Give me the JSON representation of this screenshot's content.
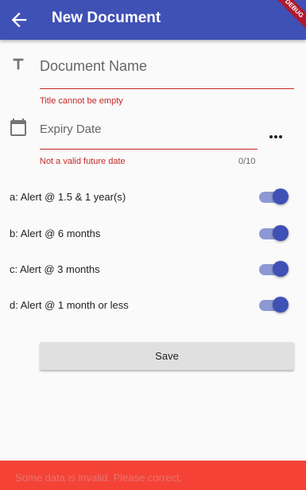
{
  "appbar": {
    "title": "New Document",
    "debug_banner": "DEBUG"
  },
  "form": {
    "name": {
      "placeholder": "Document Name",
      "error": "Title cannot be empty"
    },
    "expiry": {
      "placeholder": "Expiry Date",
      "error": "Not a valid future date",
      "counter": "0/10"
    },
    "alerts": [
      {
        "label": "a: Alert @ 1.5 & 1 year(s)",
        "enabled": true
      },
      {
        "label": "b: Alert @ 6 months",
        "enabled": true
      },
      {
        "label": "c: Alert @ 3 months",
        "enabled": true
      },
      {
        "label": "d: Alert @ 1 month or less",
        "enabled": true
      }
    ],
    "save_label": "Save"
  },
  "snackbar": {
    "message": "Some data is invalid. Please correct."
  },
  "colors": {
    "primary": "#3f51b5",
    "error": "#c62828",
    "snackbar": "#f44336",
    "switch_track": "#8e99d3"
  },
  "icons": [
    "back-arrow-icon",
    "text-format-icon",
    "calendar-icon",
    "more-horiz-icon"
  ]
}
